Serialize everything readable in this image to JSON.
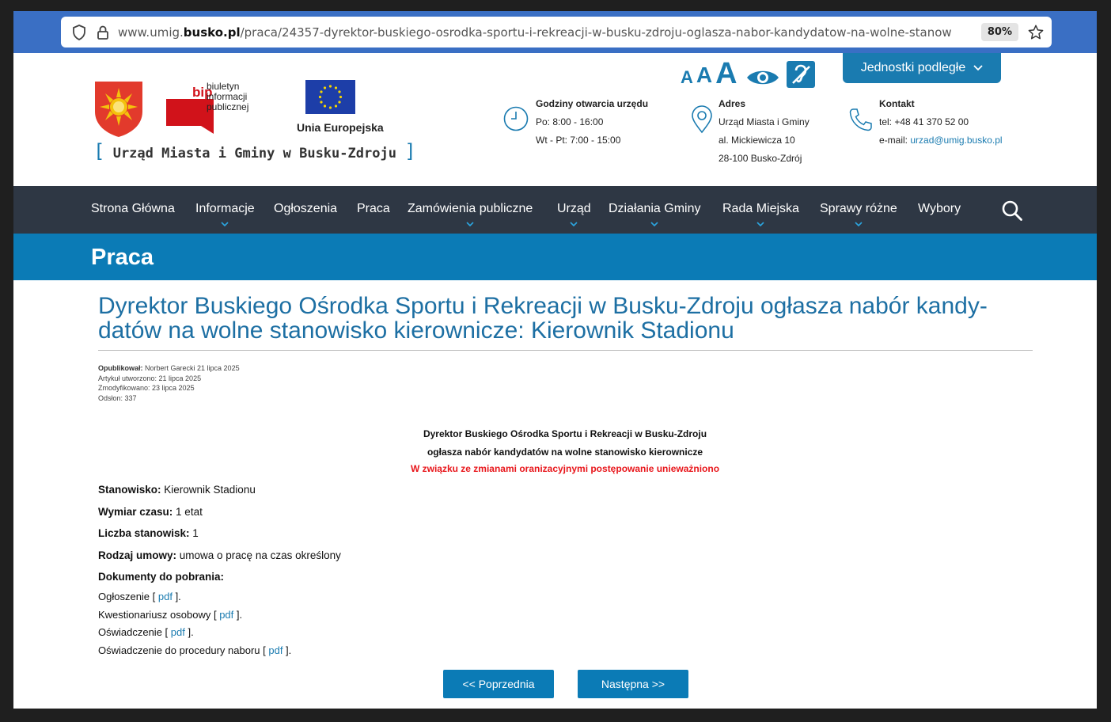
{
  "browser": {
    "url_prefix": "www.umig.",
    "url_domain": "busko.pl",
    "url_path": "/praca/24357-dyrektor-buskiego-osrodka-sportu-i-rekreacji-w-busku-zdroju-oglasza-nabor-kandydatow-na-wolne-stanow",
    "zoom": "80%"
  },
  "header": {
    "bip_line1": "biuletyn",
    "bip_line2": "informacji",
    "bip_line3": "publicznej",
    "bip_logo_text": "bip",
    "eu_label": "Unia Europejska",
    "office_name": "Urząd Miasta i Gminy w Busku-Zdroju",
    "font_a1": "A",
    "font_a2": "A",
    "font_a3": "A",
    "units_button": "Jednostki podległe",
    "hours": {
      "title": "Godziny otwarcia urzędu",
      "line1": "Po: 8:00 - 16:00",
      "line2": "Wt - Pt: 7:00 - 15:00"
    },
    "address": {
      "title": "Adres",
      "line1": "Urząd Miasta i Gminy",
      "line2": "al. Mickiewicza 10",
      "line3": "28-100 Busko-Zdrój"
    },
    "contact": {
      "title": "Kontakt",
      "phone": "tel: +48 41 370 52 00",
      "email_label": "e-mail: ",
      "email": "urzad@umig.busko.pl"
    }
  },
  "nav": {
    "items": [
      {
        "label": "Strona Główna"
      },
      {
        "label": "Informacje"
      },
      {
        "label": "Ogłoszenia"
      },
      {
        "label": "Praca"
      },
      {
        "label": "Zamówienia publiczne"
      },
      {
        "label": "Urząd"
      },
      {
        "label": "Działania Gminy"
      },
      {
        "label": "Rada Miejska"
      },
      {
        "label": "Sprawy różne"
      },
      {
        "label": "Wybory"
      }
    ]
  },
  "section_title": "Praca",
  "article": {
    "title": "Dyrektor Buskiego Ośrodka Sportu i Rekreacji w Busku-Zdroju ogłasza nabór kandy-datów na wolne stanowisko kierownicze: Kierownik Stadionu",
    "meta": {
      "published_label": "Opublikował:",
      "published_value": " Norbert Garecki  21 lipca 2025",
      "created": "Artykuł utworzono: 21 lipca 2025",
      "modified": "Zmodyfikowano: 23 lipca 2025",
      "views": "Odsłon: 337"
    },
    "heading_line1": "Dyrektor Buskiego Ośrodka Sportu i Rekreacji w Busku-Zdroju",
    "heading_line2": "ogłasza nabór kandydatów na wolne stanowisko kierownicze",
    "notice": "W związku ze zmianami oranizacyjnymi postępowanie unieważniono",
    "fields": {
      "position_label": "Stanowisko:",
      "position_value": " Kierownik Stadionu",
      "time_label": "Wymiar czasu:",
      "time_value": " 1 etat",
      "count_label": "Liczba stanowisk:",
      "count_value": " 1",
      "contract_label": "Rodzaj umowy:",
      "contract_value": " umowa o pracę na czas określony",
      "docs_label": "Dokumenty do pobrania:"
    },
    "documents": [
      {
        "name": "Ogłoszenie [ ",
        "link": "pdf",
        "end": " ]."
      },
      {
        "name": "Kwestionariusz osobowy [ ",
        "link": "pdf",
        "end": " ]."
      },
      {
        "name": "Oświadczenie [ ",
        "link": "pdf",
        "end": " ]."
      },
      {
        "name": "Oświadczenie do procedury naboru [ ",
        "link": "pdf",
        "end": " ]."
      }
    ]
  },
  "pagination": {
    "prev": "<< Poprzednia",
    "next": "Następna >>"
  }
}
